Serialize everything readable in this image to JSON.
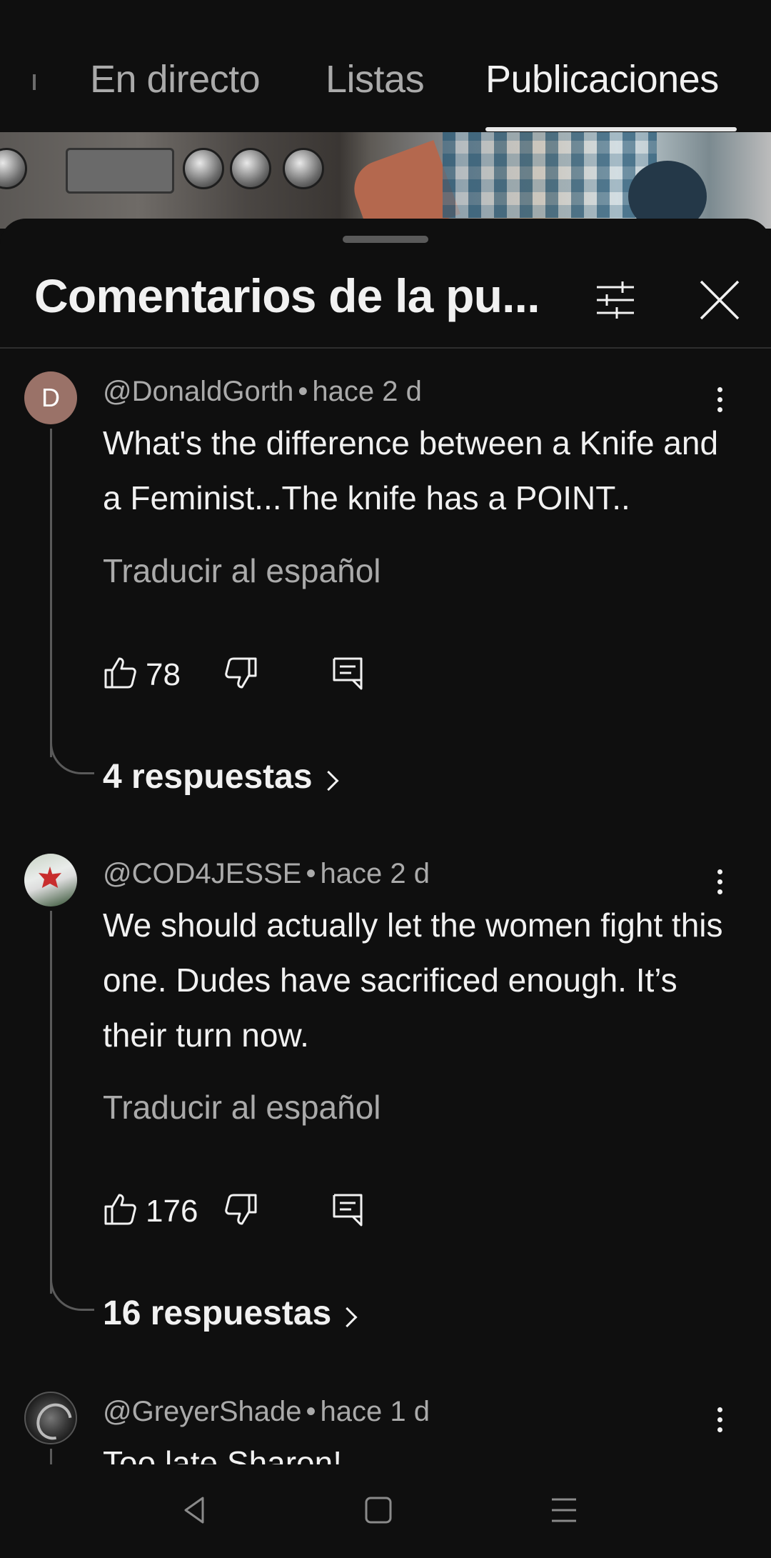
{
  "tabs": {
    "cut_off_tab": ":",
    "items": [
      {
        "label": "En directo",
        "active": false
      },
      {
        "label": "Listas",
        "active": false
      },
      {
        "label": "Publicaciones",
        "active": true
      }
    ]
  },
  "sheet": {
    "title": "Comentarios de la pu..."
  },
  "comments": [
    {
      "avatar_letter": "D",
      "author": "@DonaldGorth",
      "separator": "•",
      "time": "hace 2 d",
      "text": "What's the difference between a Knife and a Feminist...The knife has a POINT..",
      "translate": "Traducir al español",
      "likes": "78",
      "replies": "4 respuestas"
    },
    {
      "avatar_letter": "",
      "author": "@COD4JESSE",
      "separator": "•",
      "time": "hace 2 d",
      "text": "We should actually let the women fight this one. Dudes have sacrificed enough. It’s their turn now.",
      "translate": "Traducir al español",
      "likes": "176",
      "replies": "16 respuestas"
    },
    {
      "avatar_letter": "",
      "author": "@GreyerShade",
      "separator": "•",
      "time": "hace 1 d",
      "text": "Too late Sharon!"
    }
  ],
  "icons": {
    "filter": "sliders-icon",
    "close": "close-icon",
    "more": "more-vert-icon",
    "like": "thumb-up-icon",
    "dislike": "thumb-down-icon",
    "reply": "comment-icon",
    "nav_back": "triangle-back-icon",
    "nav_home": "square-home-icon",
    "nav_recent": "lines-recent-icon"
  },
  "colors": {
    "background": "#0f0f0f",
    "text_primary": "#f1f1f1",
    "text_secondary": "#aaaaaa",
    "divider": "#2e2e2e"
  }
}
